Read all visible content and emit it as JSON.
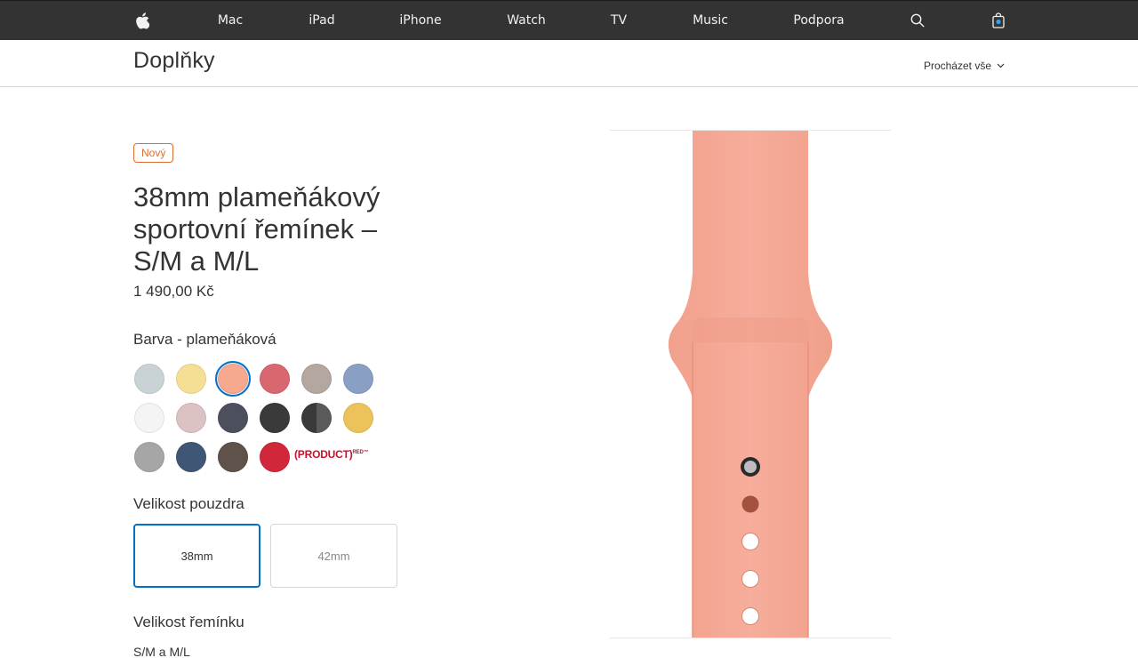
{
  "globalnav": {
    "apple_icon": "apple-logo-icon",
    "items": [
      "Mac",
      "iPad",
      "iPhone",
      "Watch",
      "TV",
      "Music",
      "Podpora"
    ],
    "search_icon": "search-icon",
    "bag_icon": "shopping-bag-icon"
  },
  "localnav": {
    "title": "Doplňky",
    "browse": "Procházet vše"
  },
  "product": {
    "badge": "Nový",
    "title": "38mm plameňákový sportovní řemínek – S/M a M/L",
    "price": "1 490,00 Kč",
    "color_label": "Barva - plameňáková",
    "colors": [
      {
        "name": "light-blue-gray",
        "hex": "#c9d3d6"
      },
      {
        "name": "yellow",
        "hex": "#f5df94"
      },
      {
        "name": "flamingo",
        "hex": "#f7a98f",
        "selected": true
      },
      {
        "name": "pink-sand",
        "hex": "#d9676f"
      },
      {
        "name": "stone",
        "hex": "#b3a7a0"
      },
      {
        "name": "azure",
        "hex": "#8a9fc4"
      },
      {
        "name": "white",
        "hex": "#f4f4f4"
      },
      {
        "name": "rose",
        "hex": "#dcc2c3"
      },
      {
        "name": "midnight",
        "hex": "#4c4f5e"
      },
      {
        "name": "black",
        "hex": "#3a3a3a"
      },
      {
        "name": "black-split",
        "hex": "#3a3a3a"
      },
      {
        "name": "gold",
        "hex": "#ecc25a"
      },
      {
        "name": "gray",
        "hex": "#a6a6a6"
      },
      {
        "name": "ocean-blue",
        "hex": "#3f5674"
      },
      {
        "name": "cocoa",
        "hex": "#5e524a"
      },
      {
        "name": "red",
        "hex": "#d0283a"
      }
    ],
    "product_red_label": "(PRODUCT)",
    "product_red_sup": "RED™",
    "case_size_label": "Velikost pouzdra",
    "case_sizes": [
      "38mm",
      "42mm"
    ],
    "band_size_label": "Velikost řemínku",
    "band_size_value": "S/M a M/L",
    "band_color": "#f5a996"
  }
}
